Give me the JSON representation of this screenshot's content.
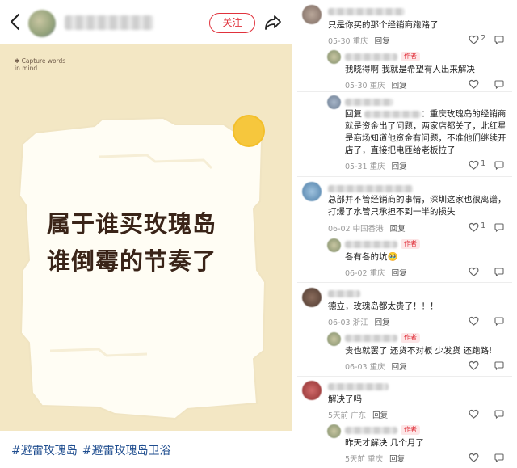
{
  "post": {
    "follow_label": "关注",
    "author_name": "**********",
    "card": {
      "note_line1": "Capture words",
      "note_line2": "in mind",
      "headline_line1": "属于谁买玫瑰岛",
      "headline_line2": "谁倒霉的节奏了"
    },
    "tags": [
      "#避雷玫瑰岛",
      "#避雷玫瑰岛卫浴"
    ]
  },
  "comments": [
    {
      "text": "只是你买的那个经销商跑路了",
      "date": "05-30",
      "location": "重庆",
      "reply_label": "回复",
      "likes": "2"
    },
    {
      "author_tag": "作者",
      "text": "我晓得啊 我就是希望有人出来解决",
      "date": "05-30",
      "location": "重庆",
      "reply_label": "回复"
    },
    {
      "reply_prefix": "回复",
      "text_after_mention": "：重庆玫瑰岛的经销商就是资金出了问题，两家店都关了，北红星是商场知道他资金有问题，不准他们继续开店了，直接把电匝给老板拉了",
      "date": "05-31",
      "location": "重庆",
      "reply_label": "回复",
      "likes": "1"
    },
    {
      "text": "总部并不管经销商的事情，深圳这家也很离谱，打爆了水管只承担不到一半的损失",
      "date": "06-02",
      "location": "中国香港",
      "reply_label": "回复",
      "likes": "1"
    },
    {
      "author_tag": "作者",
      "text": "各有各的坑🥹",
      "date": "06-02",
      "location": "重庆",
      "reply_label": "回复"
    },
    {
      "text": "德立，玫瑰岛都太贵了！！！",
      "date": "06-03",
      "location": "浙江",
      "reply_label": "回复"
    },
    {
      "author_tag": "作者",
      "text": "贵也就罢了 还货不对板 少发货 还跑路!",
      "date": "06-03",
      "location": "重庆",
      "reply_label": "回复"
    },
    {
      "text": "解决了吗",
      "date": "5天前",
      "location": "广东",
      "reply_label": "回复"
    },
    {
      "author_tag": "作者",
      "text": "昨天才解决 几个月了",
      "date": "5天前",
      "location": "重庆",
      "reply_label": "回复"
    }
  ],
  "colors": {
    "accent": "#e0323c",
    "card_bg": "#f3e7c4",
    "tag_blue": "#1f4d8f"
  }
}
